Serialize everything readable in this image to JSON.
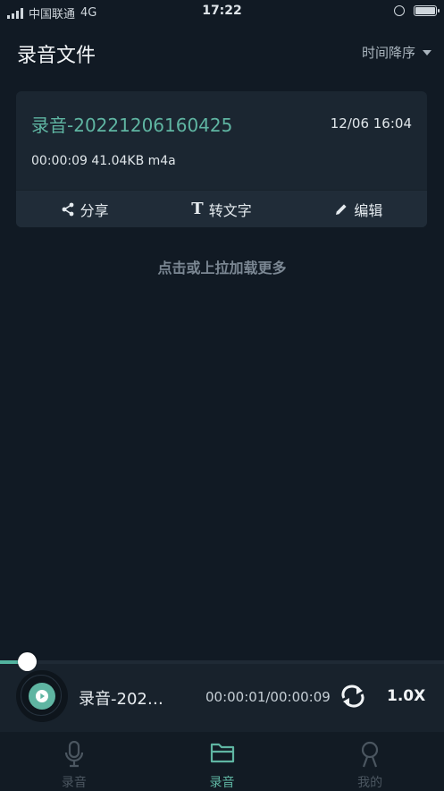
{
  "status_bar": {
    "carrier": "中国联通",
    "network": "4G",
    "time": "17:22"
  },
  "header": {
    "title": "录音文件",
    "sort_label": "时间降序"
  },
  "recordings": [
    {
      "name": "录音-20221206160425",
      "date": "12/06 16:04",
      "meta": "00:00:09 41.04KB m4a",
      "actions": {
        "share": "分享",
        "transcribe": "转文字",
        "edit": "编辑"
      }
    }
  ],
  "load_more": "点击或上拉加载更多",
  "player": {
    "title": "录音-202…",
    "time": "00:00:01/00:00:09",
    "speed": "1.0X",
    "progress": 0.11
  },
  "tabs": [
    {
      "label": "录音",
      "icon": "microphone-icon",
      "active": false
    },
    {
      "label": "录音",
      "icon": "folder-icon",
      "active": true
    },
    {
      "label": "我的",
      "icon": "person-icon",
      "active": false
    }
  ],
  "colors": {
    "accent": "#5fb5a2",
    "background": "#111a24",
    "card": "#1b2631"
  }
}
